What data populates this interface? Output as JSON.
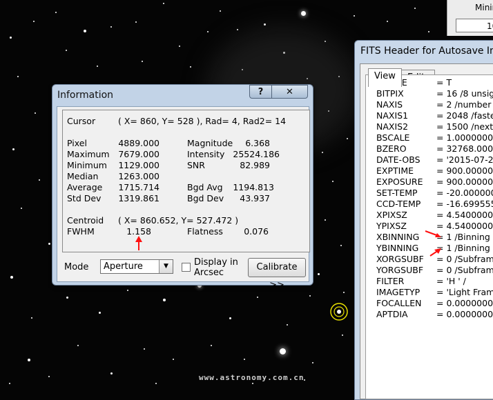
{
  "min_panel": {
    "label": "Minir",
    "value": "10"
  },
  "info": {
    "title": "Information",
    "help_label": "?",
    "close_label": "✕",
    "cursor": {
      "label": "Cursor",
      "value": "( X=  860, Y=  528 ), Rad=  4, Rad2= 14"
    },
    "stats_left": [
      {
        "label": "Pixel",
        "value": "4889.000"
      },
      {
        "label": "Maximum",
        "value": "7679.000"
      },
      {
        "label": "Minimum",
        "value": "1129.000"
      },
      {
        "label": "Median",
        "value": "1263.000"
      },
      {
        "label": "Average",
        "value": "1715.714"
      },
      {
        "label": "Std Dev",
        "value": "1319.861"
      }
    ],
    "stats_right": [
      {
        "label": "Magnitude",
        "value": "6.368"
      },
      {
        "label": "Intensity",
        "value": "25524.186"
      },
      {
        "label": "SNR",
        "value": "82.989"
      },
      {
        "label": "Bgd Avg",
        "value": "1194.813"
      },
      {
        "label": "Bgd Dev",
        "value": "43.937"
      }
    ],
    "centroid": {
      "label": "Centroid",
      "value": "( X=  860.652, Y=  527.472 )"
    },
    "fwhm": {
      "label": "FWHM",
      "value": "1.158"
    },
    "flatness": {
      "label": "Flatness",
      "value": "0.076"
    },
    "mode_label": "Mode",
    "mode_value": "Aperture",
    "arcsec_label_1": "Display in",
    "arcsec_label_2": "Arcsec",
    "calibrate_label": "Calibrate >>"
  },
  "fits": {
    "title": "FITS Header for Autosave Ima",
    "tabs": [
      "View",
      "Edit"
    ],
    "rows": [
      {
        "key": "SIMPLE",
        "value": "= T"
      },
      {
        "key": "BITPIX",
        "value": "= 16 /8 unsig"
      },
      {
        "key": "NAXIS",
        "value": "= 2 /number"
      },
      {
        "key": "NAXIS1",
        "value": "= 2048 /faste"
      },
      {
        "key": "NAXIS2",
        "value": "= 1500 /next"
      },
      {
        "key": "BSCALE",
        "value": "= 1.00000000"
      },
      {
        "key": "BZERO",
        "value": "= 32768.0000"
      },
      {
        "key": "DATE-OBS",
        "value": "= '2015-07-2"
      },
      {
        "key": "EXPTIME",
        "value": "= 900.000000"
      },
      {
        "key": "EXPOSURE",
        "value": "= 900.000000"
      },
      {
        "key": "SET-TEMP",
        "value": "= -20.000000"
      },
      {
        "key": "CCD-TEMP",
        "value": "= -16.699555"
      },
      {
        "key": "XPIXSZ",
        "value": "= 4.54000000"
      },
      {
        "key": "YPIXSZ",
        "value": "= 4.54000000"
      },
      {
        "key": "XBINNING",
        "value": "= 1 /Binning"
      },
      {
        "key": "YBINNING",
        "value": "= 1 /Binning"
      },
      {
        "key": "XORGSUBF",
        "value": "= 0 /Subfram"
      },
      {
        "key": "YORGSUBF",
        "value": "= 0 /Subfram"
      },
      {
        "key": "FILTER",
        "value": "= 'H      '  /"
      },
      {
        "key": "IMAGETYP",
        "value": "= 'Light Fram"
      },
      {
        "key": "FOCALLEN",
        "value": "= 0.00000000"
      },
      {
        "key": "APTDIA",
        "value": "= 0.00000000"
      }
    ]
  },
  "watermark": "www.astronomy.com.cn",
  "colors": {
    "arrow": "#ff1010",
    "target": "#e8e000"
  }
}
